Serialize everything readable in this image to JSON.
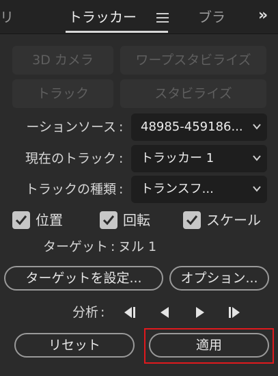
{
  "tabs": {
    "left_partial": "リ",
    "active": "トラッカー",
    "right_partial": "ブラ"
  },
  "buttons_top": {
    "camera3d": "3D カメラ",
    "warp_stabilize": "ワープスタビライズ",
    "track": "トラック",
    "stabilize": "スタビライズ"
  },
  "fields": {
    "motion_source_label": "ーションソース",
    "motion_source_value": "48985-459186...",
    "current_track_label": "現在のトラック",
    "current_track_value": "トラッカー 1",
    "track_type_label": "トラックの種類",
    "track_type_value": "トランスフ...",
    "colon": ":"
  },
  "checks": {
    "position": "位置",
    "rotation": "回転",
    "scale": "スケール"
  },
  "target": {
    "label": "ターゲット",
    "colon": ":",
    "value": "ヌル 1"
  },
  "actions": {
    "set_target": "ターゲットを設定...",
    "options": "オプション..."
  },
  "analyze": {
    "label": "分析",
    "colon": ":"
  },
  "bottom": {
    "reset": "リセット",
    "apply": "適用"
  },
  "colors": {
    "panel_bg": "#2b2b2b",
    "field_bg": "#1e1e1e",
    "highlight": "#e0191d"
  }
}
